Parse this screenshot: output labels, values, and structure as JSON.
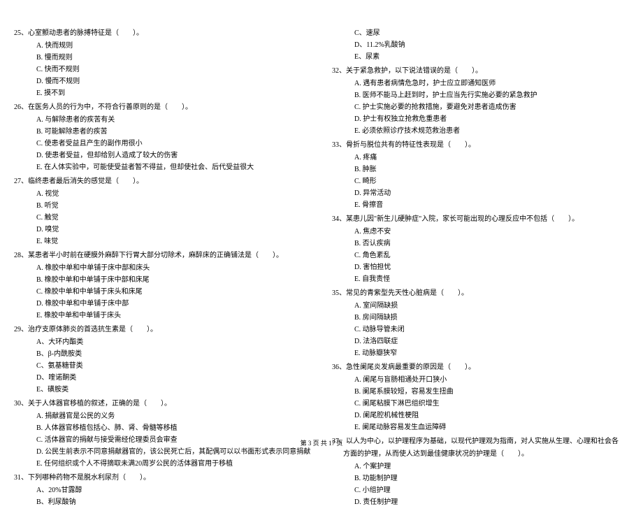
{
  "footer": "第 3 页 共 17 页",
  "left_questions": [
    {
      "num": "25、",
      "text": "心室颤动患者的脉搏特征是（　　）。",
      "options": [
        "A. 快而规则",
        "B. 慢而规则",
        "C. 快而不规则",
        "D. 慢而不规则",
        "E. 摸不到"
      ]
    },
    {
      "num": "26、",
      "text": "在医务人员的行为中，不符合行善原则的是（　　）。",
      "options": [
        "A. 与解除患者的疾苦有关",
        "B. 可能解除患者的疾苦",
        "C. 使患者受益且产生的副作用很小",
        "D. 使患者受益，但却给别人造成了较大的伤害",
        "E. 在人体实验中，可能使受益者暂不得益，但却使社会、后代受益很大"
      ]
    },
    {
      "num": "27、",
      "text": "临终患者最后消失的感觉是（　　）。",
      "options": [
        "A. 视觉",
        "B. 听觉",
        "C. 触觉",
        "D. 嗅觉",
        "E. 味觉"
      ]
    },
    {
      "num": "28、",
      "text": "某患者半小时前在硬膜外麻醉下行胃大部分切除术，麻醉床的正确铺法是（　　）。",
      "options": [
        "A. 橡胶中单和中单铺于床中部和床头",
        "B. 橡胶中单和中单铺于床中部和床尾",
        "C. 橡胶中单和中单铺于床头和床尾",
        "D. 橡胶中单和中单铺于床中部",
        "E. 橡胶中单和中单铺于床头"
      ]
    },
    {
      "num": "29、",
      "text": "治疗支原体肺炎的首选抗生素是（　　）。",
      "options": [
        "A、大环内酯类",
        "B、β-内酰胺类",
        "C、氨基糖苷类",
        "D、喹诺酮类",
        "E、磺胺类"
      ]
    },
    {
      "num": "30、",
      "text": "关于人体器官移植的叙述，正确的是（　　）。",
      "options": [
        "A. 捐献器官是公民的义务",
        "B. 人体器官移植包括心、肺、肾、骨髓等移植",
        "C. 活体器官的捐献与接受需经伦理委员会审查",
        "D. 公民生前表示不同意捐献器官的，该公民死亡后，其配偶可以以书面形式表示同意捐献",
        "E. 任何组织或个人不得摘取未满20周岁公民的活体器官用于移植"
      ]
    },
    {
      "num": "31、",
      "text": "下列哪种药物不是脱水利尿剂（　　）。",
      "options": [
        "A、20%甘露醇",
        "B、利尿酸钠"
      ]
    }
  ],
  "right_top_options": [
    "C、速尿",
    "D、11.2%乳酸钠",
    "E、尿素"
  ],
  "right_questions": [
    {
      "num": "32、",
      "text": "关于紧急救护，以下说法错误的是（　　）。",
      "options": [
        "A. 遇有患者病情危急时，护士应立即通知医师",
        "B. 医师不能马上赶到时，护士应当先行实施必要的紧急救护",
        "C. 护士实施必要的抢救措施，要避免对患者造成伤害",
        "D. 护士有权独立抢救危重患者",
        "E. 必须依照诊疗技术规范救治患者"
      ]
    },
    {
      "num": "33、",
      "text": "骨折与脱位共有的特征性表现是（　　）。",
      "options": [
        "A. 疼痛",
        "B. 肿胀",
        "C. 畸形",
        "D. 异常活动",
        "E. 骨擦音"
      ]
    },
    {
      "num": "34、",
      "text": "某患儿因\"新生儿硬肿症\"入院，家长可能出现的心理反应中不包括（　　）。",
      "options": [
        "A. 焦虑不安",
        "B. 否认疾病",
        "C. 角色紊乱",
        "D. 害怕担忧",
        "E. 自我责怪"
      ]
    },
    {
      "num": "35、",
      "text": "常见的青紫型先天性心脏病是（　　）。",
      "options": [
        "A. 室间隔缺损",
        "B. 房间隔缺损",
        "C. 动脉导管未闭",
        "D. 法洛四联症",
        "E. 动脉瓣狭窄"
      ]
    },
    {
      "num": "36、",
      "text": "急性阑尾炎发病最重要的原因是（　　）。",
      "options": [
        "A. 阑尾与盲肠相通处开口狭小",
        "B. 阑尾系膜较短，容易发生扭曲",
        "C. 阑尾粘膜下淋巴组织增生",
        "D. 阑尾腔机械性梗阻",
        "E. 阑尾动脉容易发生血运障碍"
      ]
    },
    {
      "num": "37、",
      "text": "以人为中心，以护理程序为基础，以现代护理观为指南，对人实施从生理、心理和社会各",
      "text2": "方面的护理，从而使人达到最佳健康状况的护理是（　　）。",
      "options": [
        "A. 个案护理",
        "B. 功能制护理",
        "C. 小组护理",
        "D. 责任制护理"
      ]
    }
  ]
}
